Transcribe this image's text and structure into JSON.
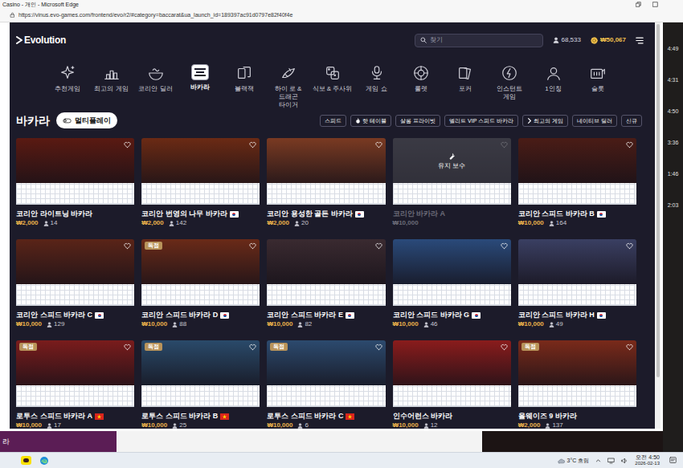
{
  "browser": {
    "title": "Casino - 개인 - Microsoft Edge",
    "url": "https://vinus.evo-games.com/frontend/evo/r2/#category=baccarat&ua_launch_id=189397ac91d0797e82f40f4e"
  },
  "header": {
    "logo": "Evolution",
    "search_placeholder": "찾기",
    "players": "68,533",
    "balance": "₩50,067"
  },
  "categories": [
    {
      "label": "추천게임",
      "selected": false
    },
    {
      "label": "최고의 게임",
      "selected": false
    },
    {
      "label": "코리안 딜러",
      "selected": false
    },
    {
      "label": "바카라",
      "selected": true
    },
    {
      "label": "블랙잭",
      "selected": false
    },
    {
      "label": "하이 로 & 드래곤 타이거",
      "selected": false
    },
    {
      "label": "식보 & 주사위",
      "selected": false
    },
    {
      "label": "게임 쇼",
      "selected": false
    },
    {
      "label": "룰렛",
      "selected": false
    },
    {
      "label": "포커",
      "selected": false
    },
    {
      "label": "인스턴트 게임",
      "selected": false
    },
    {
      "label": "1인칭",
      "selected": false
    },
    {
      "label": "슬롯",
      "selected": false
    }
  ],
  "section": {
    "title": "바카라",
    "multiplay": "멀티플레이"
  },
  "filters": [
    {
      "label": "스피드",
      "kind": "plain"
    },
    {
      "label": "핫 테이블",
      "kind": "hot"
    },
    {
      "label": "살롱 프라이빗",
      "kind": "plain"
    },
    {
      "label": "엘리트 VIP 스피드 바카라",
      "kind": "plain"
    },
    {
      "label": "최고의 게임",
      "kind": "top"
    },
    {
      "label": "네이티브 딜러",
      "kind": "plain"
    },
    {
      "label": "신규",
      "kind": "plain"
    }
  ],
  "tables": [
    {
      "name": "코리안 라이트닝 바카라",
      "flag": "none",
      "min_bet": "₩2,000",
      "players": "14",
      "maintenance": false,
      "color": "#5a1a12"
    },
    {
      "name": "코리안 번영의 나무 바카라",
      "flag": "kr",
      "min_bet": "₩2,000",
      "players": "142",
      "maintenance": false,
      "color": "#6b2a14"
    },
    {
      "name": "코리안 용성한 골든 바카라",
      "flag": "kr",
      "min_bet": "₩2,000",
      "players": "20",
      "maintenance": false,
      "color": "#7a3a22"
    },
    {
      "name": "코리안 바카라 A",
      "flag": "none",
      "min_bet": "₩10,000",
      "overlay": "유지 보수",
      "maintenance": true,
      "color": "#3b3a44"
    },
    {
      "name": "코리안 스피드 바카라 B",
      "flag": "kr",
      "min_bet": "₩10,000",
      "players": "164",
      "maintenance": false,
      "color": "#4a1c16"
    },
    {
      "name": "코리안 스피드 바카라 C",
      "flag": "kr",
      "min_bet": "₩10,000",
      "players": "129",
      "maintenance": false,
      "color": "#5a2418"
    },
    {
      "name": "코리안 스피드 바카라 D",
      "flag": "kr",
      "min_bet": "₩10,000",
      "players": "88",
      "badge": "독점",
      "maintenance": false,
      "color": "#6a2a18"
    },
    {
      "name": "코리안 스피드 바카라 E",
      "flag": "kr",
      "min_bet": "₩10,000",
      "players": "82",
      "maintenance": false,
      "color": "#3a2a30"
    },
    {
      "name": "코리안 스피드 바카라 G",
      "flag": "kr",
      "min_bet": "₩10,000",
      "players": "46",
      "maintenance": false,
      "color": "#2a4a7a"
    },
    {
      "name": "코리안 스피드 바카라 H",
      "flag": "kr",
      "min_bet": "₩10,000",
      "players": "49",
      "maintenance": false,
      "color": "#3a3f62"
    },
    {
      "name": "로투스 스피드 바카라 A",
      "flag": "vn",
      "min_bet": "₩10,000",
      "players": "17",
      "badge": "독점",
      "maintenance": false,
      "color": "#7a1c1c"
    },
    {
      "name": "로투스 스피드 바카라 B",
      "flag": "vn",
      "min_bet": "₩10,000",
      "players": "25",
      "badge": "독점",
      "maintenance": false,
      "color": "#2a4a6a"
    },
    {
      "name": "로투스 스피드 바카라 C",
      "flag": "vn",
      "min_bet": "₩10,000",
      "players": "6",
      "badge": "독점",
      "maintenance": false,
      "color": "#2c4a6e"
    },
    {
      "name": "인수어런스 바카라",
      "flag": "none",
      "min_bet": "₩10,000",
      "players": "12",
      "maintenance": false,
      "color": "#8a1c1c"
    },
    {
      "name": "올웨이즈 9 바카라",
      "flag": "none",
      "min_bet": "₩2,000",
      "players": "137",
      "badge": "독점",
      "maintenance": false,
      "color": "#7a2a1a"
    }
  ],
  "side_panel": {
    "times": [
      "4:49",
      "4:31",
      "4:50",
      "3:36",
      "1:46",
      "2:03"
    ]
  },
  "background_app": {
    "text": "라"
  },
  "taskbar": {
    "weather": "3°C 흐림",
    "time": "오전 4:50",
    "date": "2026-02-13"
  }
}
